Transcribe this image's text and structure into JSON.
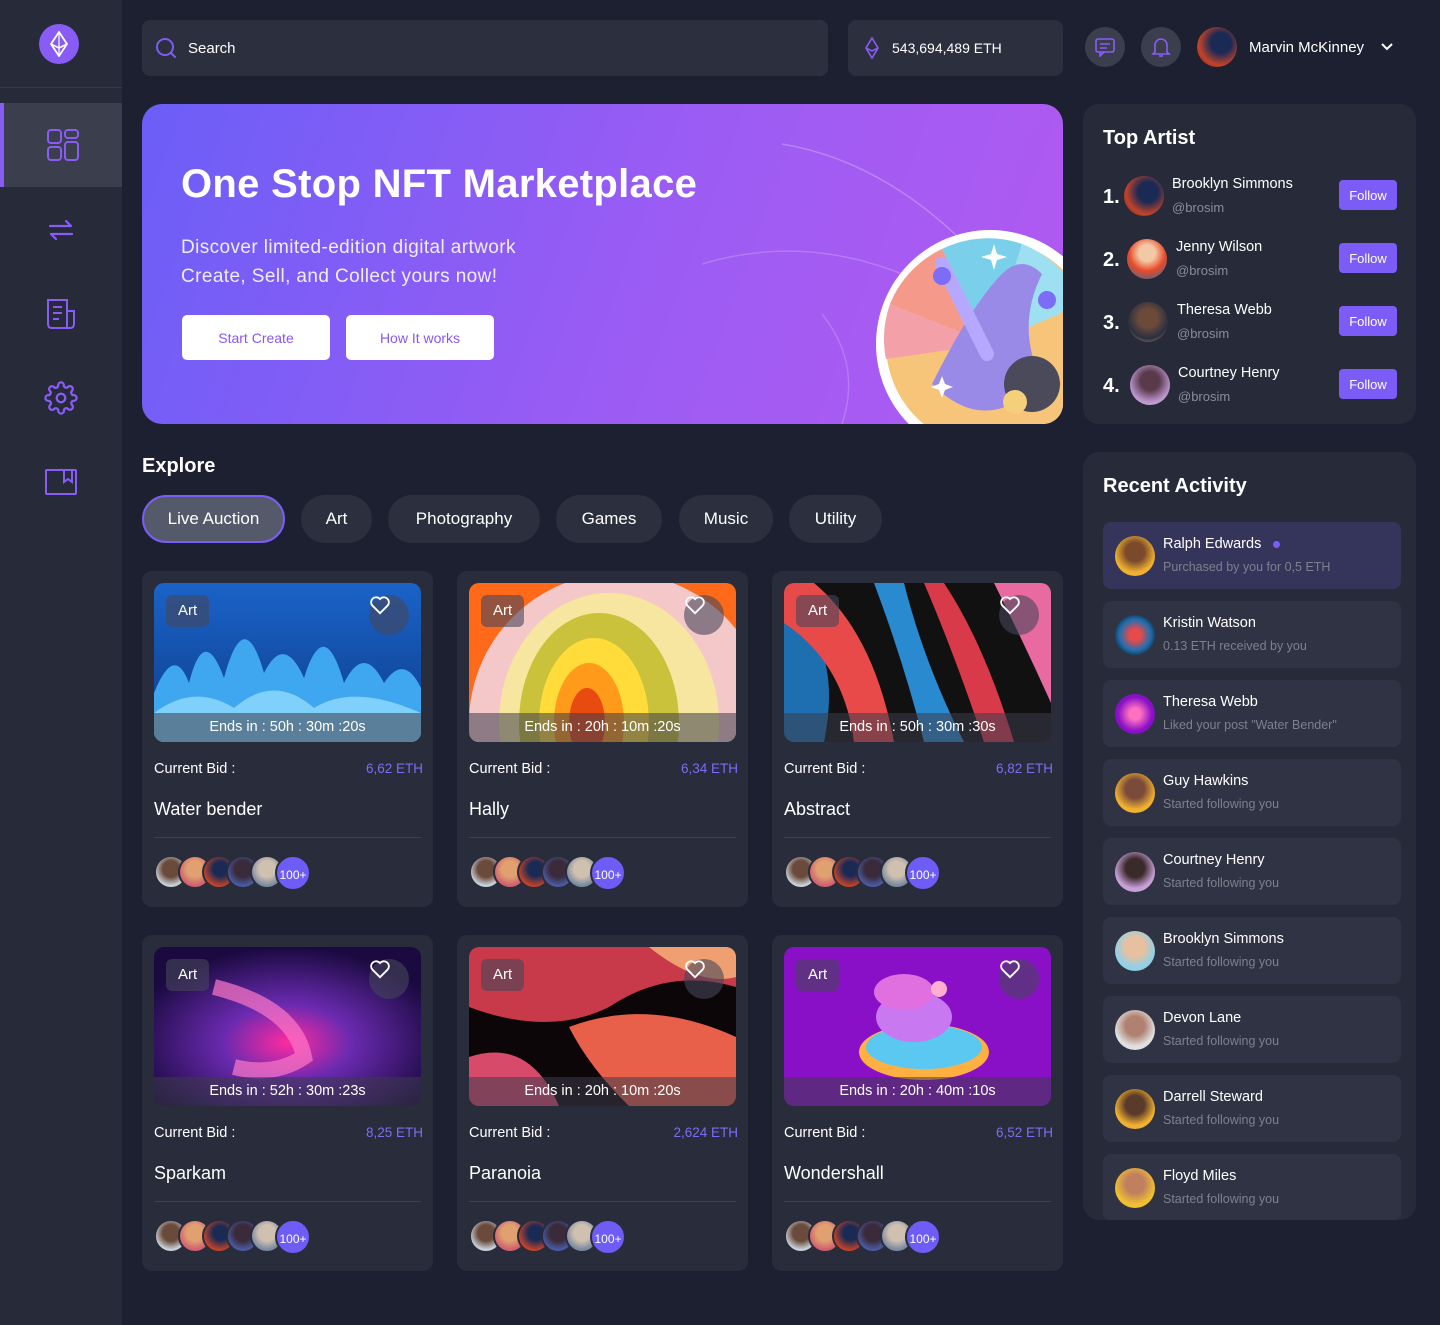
{
  "header": {
    "search_placeholder": "Search",
    "wallet_balance": "543,694,489 ETH",
    "user_name": "Marvin McKinney"
  },
  "sidebar": {
    "items": [
      {
        "icon": "dashboard-icon",
        "active": true
      },
      {
        "icon": "transfer-icon",
        "active": false
      },
      {
        "icon": "document-icon",
        "active": false
      },
      {
        "icon": "settings-icon",
        "active": false
      },
      {
        "icon": "bookmark-icon",
        "active": false
      }
    ]
  },
  "hero": {
    "title": "One Stop NFT Marketplace",
    "line1": "Discover limited-edition digital artwork",
    "line2": "Create, Sell, and Collect yours now!",
    "primary_button": "Start Create",
    "secondary_button": "How It works"
  },
  "explore": {
    "title": "Explore",
    "chips": [
      "Live Auction",
      "Art",
      "Photography",
      "Games",
      "Music",
      "Utility"
    ],
    "active_chip": "Live Auction"
  },
  "cards": [
    {
      "tag": "Art",
      "ends": "Ends in : 50h : 30m :20s",
      "bid_label": "Current Bid :",
      "bid": "6,62 ETH",
      "title": "Water bender",
      "more": "100+"
    },
    {
      "tag": "Art",
      "ends": "Ends in : 20h : 10m :20s",
      "bid_label": "Current Bid :",
      "bid": "6,34 ETH",
      "title": "Hally",
      "more": "100+"
    },
    {
      "tag": "Art",
      "ends": "Ends in : 50h : 30m :30s",
      "bid_label": "Current Bid :",
      "bid": "6,82 ETH",
      "title": "Abstract",
      "more": "100+"
    },
    {
      "tag": "Art",
      "ends": "Ends in : 52h : 30m :23s",
      "bid_label": "Current Bid :",
      "bid": "8,25 ETH",
      "title": "Sparkam",
      "more": "100+"
    },
    {
      "tag": "Art",
      "ends": "Ends in : 20h : 10m :20s",
      "bid_label": "Current Bid :",
      "bid": "2,624 ETH",
      "title": "Paranoia",
      "more": "100+"
    },
    {
      "tag": "Art",
      "ends": "Ends in : 20h : 40m :10s",
      "bid_label": "Current Bid :",
      "bid": "6,52 ETH",
      "title": "Wondershall",
      "more": "100+"
    }
  ],
  "top_artist": {
    "title": "Top Artist",
    "follow_label": "Follow",
    "artists": [
      {
        "rank": "1.",
        "name": "Brooklyn Simmons",
        "handle": "@brosim"
      },
      {
        "rank": "2.",
        "name": "Jenny Wilson",
        "handle": "@brosim"
      },
      {
        "rank": "3.",
        "name": "Theresa Webb",
        "handle": "@brosim"
      },
      {
        "rank": "4.",
        "name": "Courtney Henry",
        "handle": "@brosim"
      }
    ]
  },
  "recent_activity": {
    "title": "Recent Activity",
    "items": [
      {
        "name": "Ralph Edwards",
        "text": "Purchased by you for 0,5 ETH",
        "unread": true
      },
      {
        "name": "Kristin Watson",
        "text": "0.13 ETH received by you"
      },
      {
        "name": "Theresa Webb",
        "text": "Liked your post \"Water Bender\""
      },
      {
        "name": "Guy Hawkins",
        "text": "Started following you"
      },
      {
        "name": "Courtney Henry",
        "text": "Started following you"
      },
      {
        "name": "Brooklyn Simmons",
        "text": "Started following you"
      },
      {
        "name": "Devon Lane",
        "text": "Started following you"
      },
      {
        "name": "Darrell Steward",
        "text": "Started following you"
      },
      {
        "name": "Floyd Miles",
        "text": "Started following you"
      }
    ]
  },
  "colors": {
    "accent": "#7c5cf6",
    "background": "#1d2030",
    "panel": "#262a39"
  }
}
